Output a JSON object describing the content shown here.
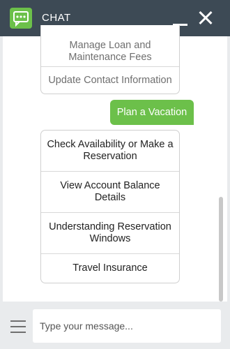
{
  "header": {
    "title": "CHAT",
    "logo_icon": "chat-bubble-icon",
    "minimize_icon": "minimize-icon",
    "close_icon": "close-icon",
    "background": "#3d4a55",
    "accent": "#6cc04a"
  },
  "conversation": {
    "previous_options": [
      "Manage Loan and Maintenance Fees",
      "Update Contact Information"
    ],
    "user_message": "Plan a Vacation",
    "current_options": [
      "Check Availability or Make a Reservation",
      "View Account Balance Details",
      "Understanding Reservation Windows",
      "Travel Insurance"
    ]
  },
  "composer": {
    "menu_icon": "hamburger-menu-icon",
    "placeholder": "Type your message..."
  }
}
